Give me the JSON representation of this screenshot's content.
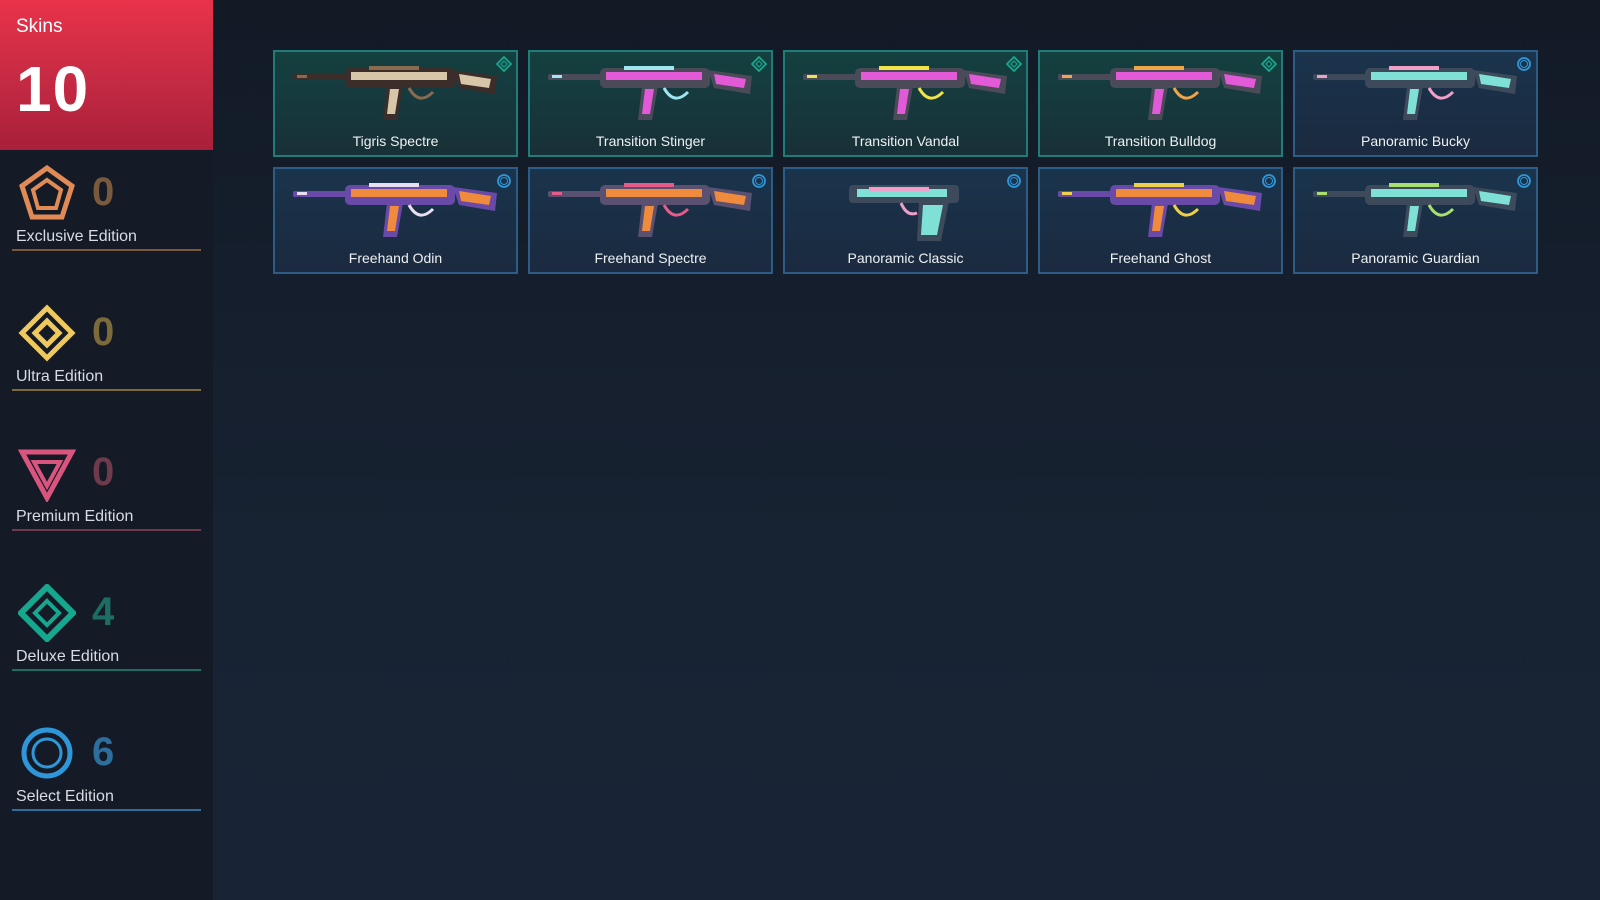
{
  "summary": {
    "label": "Skins",
    "count": "10"
  },
  "tiers": [
    {
      "name": "Exclusive Edition",
      "count": "0",
      "icon": "exclusive-tier-icon",
      "color": "#e08a56",
      "count_color": "#7a5a3c"
    },
    {
      "name": "Ultra Edition",
      "count": "0",
      "icon": "ultra-tier-icon",
      "color": "#efc85e",
      "count_color": "#7d6a3a"
    },
    {
      "name": "Premium Edition",
      "count": "0",
      "icon": "premium-tier-icon",
      "color": "#d9557e",
      "count_color": "#6e3a4c"
    },
    {
      "name": "Deluxe Edition",
      "count": "4",
      "icon": "deluxe-tier-icon",
      "color": "#16a88f",
      "count_color": "#1c6e64"
    },
    {
      "name": "Select Edition",
      "count": "6",
      "icon": "select-tier-icon",
      "color": "#2f97d9",
      "count_color": "#2d6f9c"
    }
  ],
  "skins": [
    {
      "name": "Tigris Spectre",
      "tier": "deluxe",
      "palette": [
        "#3b2d2a",
        "#d8c6a8",
        "#8a6b4f"
      ]
    },
    {
      "name": "Transition Stinger",
      "tier": "deluxe",
      "palette": [
        "#4a4a58",
        "#e35ad8",
        "#9fe6f0"
      ]
    },
    {
      "name": "Transition Vandal",
      "tier": "deluxe",
      "palette": [
        "#4a4a58",
        "#e35ad8",
        "#f3e24a"
      ]
    },
    {
      "name": "Transition Bulldog",
      "tier": "deluxe",
      "palette": [
        "#4a4a58",
        "#e35ad8",
        "#f2a548"
      ]
    },
    {
      "name": "Panoramic Bucky",
      "tier": "select",
      "palette": [
        "#3d4a5c",
        "#7fe0d8",
        "#f0a0c8"
      ]
    },
    {
      "name": "Freehand Odin",
      "tier": "select",
      "palette": [
        "#6a4aa8",
        "#f08a3c",
        "#e8e0f0"
      ]
    },
    {
      "name": "Freehand Spectre",
      "tier": "select",
      "palette": [
        "#5a5070",
        "#f08a3c",
        "#e85a8a"
      ]
    },
    {
      "name": "Panoramic Classic",
      "tier": "select",
      "palette": [
        "#3d4a5c",
        "#7fe0d8",
        "#f0a0c8"
      ]
    },
    {
      "name": "Freehand Ghost",
      "tier": "select",
      "palette": [
        "#6a4aa8",
        "#f08a3c",
        "#f0d048"
      ]
    },
    {
      "name": "Panoramic Guardian",
      "tier": "select",
      "palette": [
        "#3d4a5c",
        "#7fe0d8",
        "#a8e070"
      ]
    }
  ]
}
